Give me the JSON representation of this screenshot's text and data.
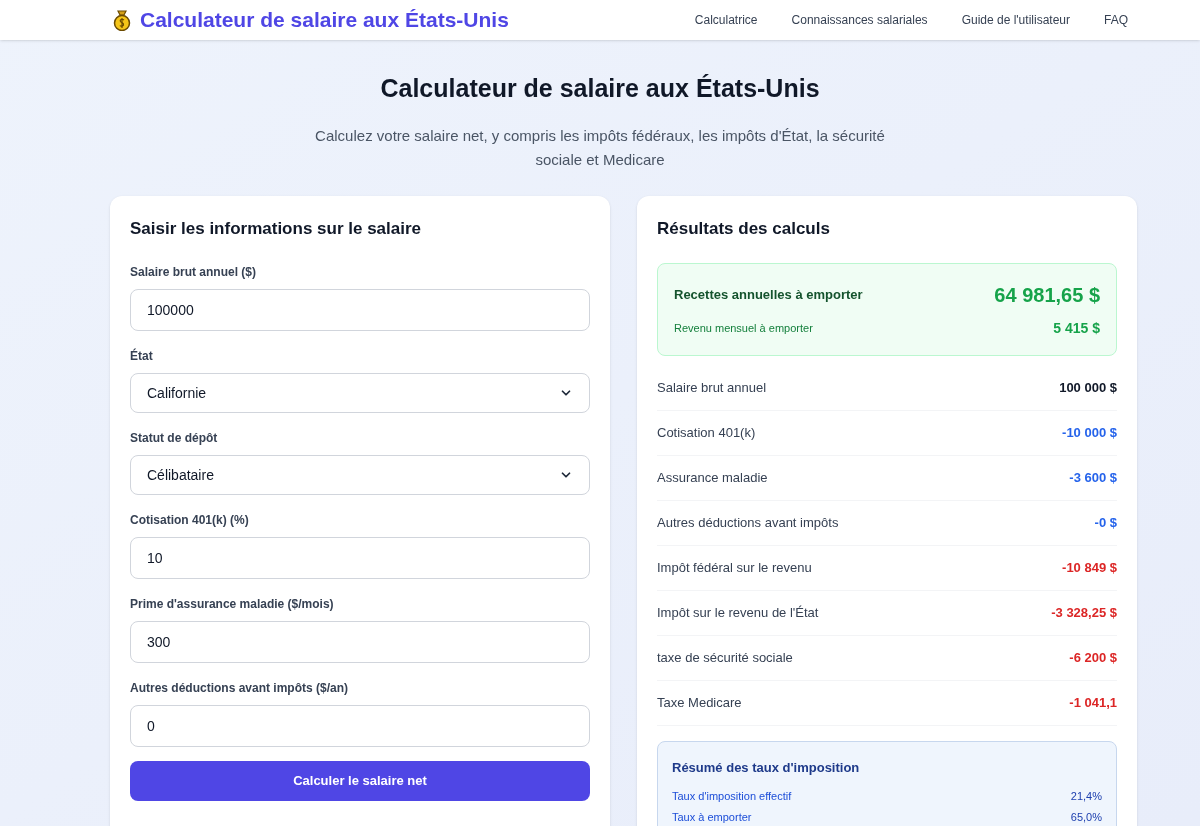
{
  "header": {
    "logo_title": "Calculateur de salaire aux États-Unis",
    "nav": [
      "Calculatrice",
      "Connaissances salariales",
      "Guide de l'utilisateur",
      "FAQ"
    ]
  },
  "hero": {
    "title": "Calculateur de salaire aux États-Unis",
    "subtitle": "Calculez votre salaire net, y compris les impôts fédéraux, les impôts d'État, la sécurité sociale et Medicare"
  },
  "form": {
    "title": "Saisir les informations sur le salaire",
    "fields": [
      {
        "kind": "input",
        "label": "Salaire brut annuel ($)",
        "value": "100000"
      },
      {
        "kind": "select",
        "label": "État",
        "value": "Californie"
      },
      {
        "kind": "select",
        "label": "Statut de dépôt",
        "value": "Célibataire"
      },
      {
        "kind": "input",
        "label": "Cotisation 401(k) (%)",
        "value": "10"
      },
      {
        "kind": "input",
        "label": "Prime d'assurance maladie ($/mois)",
        "value": "300"
      },
      {
        "kind": "input",
        "label": "Autres déductions avant impôts ($/an)",
        "value": "0"
      }
    ],
    "submit": "Calculer le salaire net"
  },
  "results": {
    "title": "Résultats des calculs",
    "take_home": {
      "annual_label": "Recettes annuelles à emporter",
      "annual_value": "64 981,65 $",
      "monthly_label": "Revenu mensuel à emporter",
      "monthly_value": "5 415 $"
    },
    "rows": [
      {
        "kind": "gross",
        "label": "Salaire brut annuel",
        "value": "100 000 $"
      },
      {
        "kind": "deduction",
        "label": "Cotisation 401(k)",
        "value": "-10 000 $"
      },
      {
        "kind": "deduction",
        "label": "Assurance maladie",
        "value": "-3 600 $"
      },
      {
        "kind": "deduction",
        "label": "Autres déductions avant impôts",
        "value": "-0 $"
      },
      {
        "kind": "tax",
        "label": "Impôt fédéral sur le revenu",
        "value": "-10 849 $"
      },
      {
        "kind": "tax",
        "label": "Impôt sur le revenu de l'État",
        "value": "-3 328,25 $"
      },
      {
        "kind": "tax",
        "label": "taxe de sécurité sociale",
        "value": "-6 200 $"
      },
      {
        "kind": "tax",
        "label": "Taxe Medicare",
        "value": "-1 041,1"
      }
    ],
    "summary": {
      "title": "Résumé des taux d'imposition",
      "rows": [
        {
          "label": "Taux d'imposition effectif",
          "value": "21,4%"
        },
        {
          "label": "Taux à emporter",
          "value": "65,0%"
        }
      ]
    }
  }
}
